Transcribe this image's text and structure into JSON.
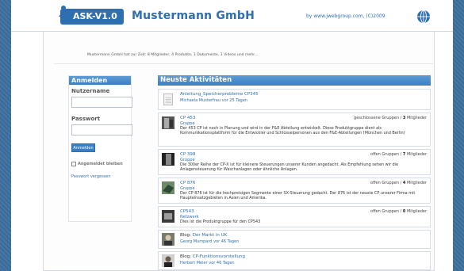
{
  "header": {
    "logo_text": "ASK-V1.0",
    "company": "Mustermann GmbH",
    "copyright": "by www.jwebgroup.com, (C)2009"
  },
  "stats": "Mustermann GmbH hat zur Zeit: 8 Mitglieder, 4 Produkte, 1 Dokumente, 1 Videos und mehr...",
  "login": {
    "title": "Anmelden",
    "username_label": "Nutzername",
    "password_label": "Passwort",
    "button": "Anmelden",
    "stay_logged_in": "Angemeldet bleiben",
    "forgot": "Passwort vergessen"
  },
  "activities": {
    "title": "Neuste Aktivitäten",
    "items": [
      {
        "title": "Anleitung_Speicherprobleme CP345",
        "meta": "Michaela Musterfrau vor 25 Tagen"
      },
      {
        "title": "CP 453",
        "sub": "Gruppe",
        "status": "geschlossene Gruppen / ",
        "count": "3",
        "count_label": " Mitglieder",
        "desc": "Der 453 CP ist noch in Planung und wird in der F&E Abteilung entwickelt. Diese Produktgruppe dient als Kommunikationsplattform für die Entwickler und Schlüsselpersonen aus den F&E-Abteilungen (München und Berlin)"
      },
      {
        "title": "CP 398",
        "sub": "Gruppe",
        "status": "offen Gruppen / ",
        "count": "7",
        "count_label": " Mitglieder",
        "desc": "Die 300er Reihe der CP-X ist für kleinere Steuerungen unserer Kunden angedacht. Als Empfehlung sehen wir die Anlagensteuerung für Waschanlagen oder ähnliche Anlagen."
      },
      {
        "title": "CP 876",
        "sub": "Gruppe",
        "status": "offen Gruppen / ",
        "count": "4",
        "count_label": " Mitglieder",
        "desc": "Der CP 876 ist für die hochpreisigen Segmente einer SX-Steuerung gedacht. Der 876 ist der neuste CP unserer Firma mit Haupteinsatzgebieten in Asien und Amerika."
      },
      {
        "title": "CP543",
        "sub": "Netzwerk",
        "status": "offen Gruppen / ",
        "count": "0",
        "count_label": " Mitglieder",
        "desc": "Dies ist die Produktgruppe für den CP543"
      },
      {
        "prefix": "Blog: ",
        "title": "Der Markt in UK",
        "meta": "Georg Mumpard vor 46 Tagen"
      },
      {
        "prefix": "Blog: ",
        "title": "CP-Funktionsvorstellung",
        "meta": "Herbert Meier vor 46 Tagen"
      }
    ]
  },
  "colors": {
    "brand": "#2e6fb2",
    "panel_head": "#3b7fc3",
    "background": "#3d6e99"
  }
}
